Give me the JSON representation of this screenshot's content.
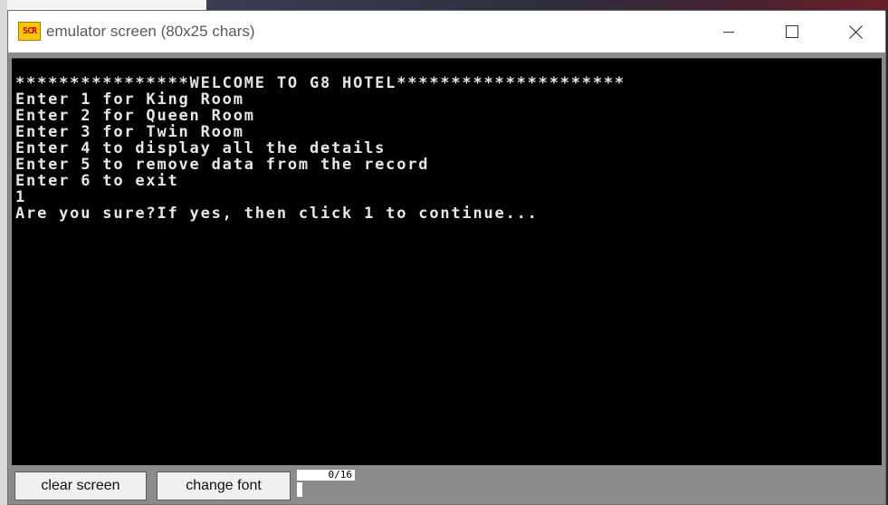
{
  "window": {
    "title": "emulator screen (80x25 chars)",
    "icon_text": "SCR",
    "icon_name": "emulator-app-icon"
  },
  "window_controls": {
    "minimize_icon": "minimize-icon",
    "maximize_icon": "maximize-icon",
    "close_icon": "close-icon"
  },
  "screen": {
    "lines": [
      "****************WELCOME TO G8 HOTEL*********************",
      "Enter 1 for King Room",
      "Enter 2 for Queen Room",
      "Enter 3 for Twin Room",
      "Enter 4 to display all the details",
      "Enter 5 to remove data from the record",
      "Enter 6 to exit",
      "1",
      "Are you sure?If yes, then click 1 to continue..."
    ]
  },
  "toolbar": {
    "clear_label": "clear screen",
    "change_font_label": "change font",
    "counter": "0/16"
  },
  "colors": {
    "screen_bg": "#000000",
    "screen_text": "#e6e6e6",
    "panel_bg": "#8b8b8b",
    "icon_bg": "#f7c800",
    "icon_text": "#d00000"
  }
}
